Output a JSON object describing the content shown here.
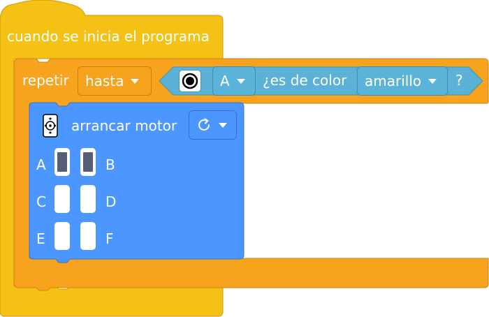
{
  "hat_block": {
    "label": "cuando se inicia el programa",
    "color": "#f5c114"
  },
  "repeat_block": {
    "label": "repetir",
    "mode": "hasta",
    "color": "#f7a31d",
    "condition": {
      "sensor_icon": "color-sensor-icon",
      "port": "A",
      "text": "¿es de color",
      "color_value": "amarillo",
      "question_mark": "?",
      "color": "#5cb1d6"
    }
  },
  "motor_block": {
    "label": "arrancar motor",
    "icon": "motor-remote-icon",
    "direction_icon": "clockwise-arrow-icon",
    "color": "#4c97ff",
    "ports": [
      {
        "name": "A",
        "selected": true
      },
      {
        "name": "B",
        "selected": true
      },
      {
        "name": "C",
        "selected": false
      },
      {
        "name": "D",
        "selected": false
      },
      {
        "name": "E",
        "selected": false
      },
      {
        "name": "F",
        "selected": false
      }
    ]
  }
}
